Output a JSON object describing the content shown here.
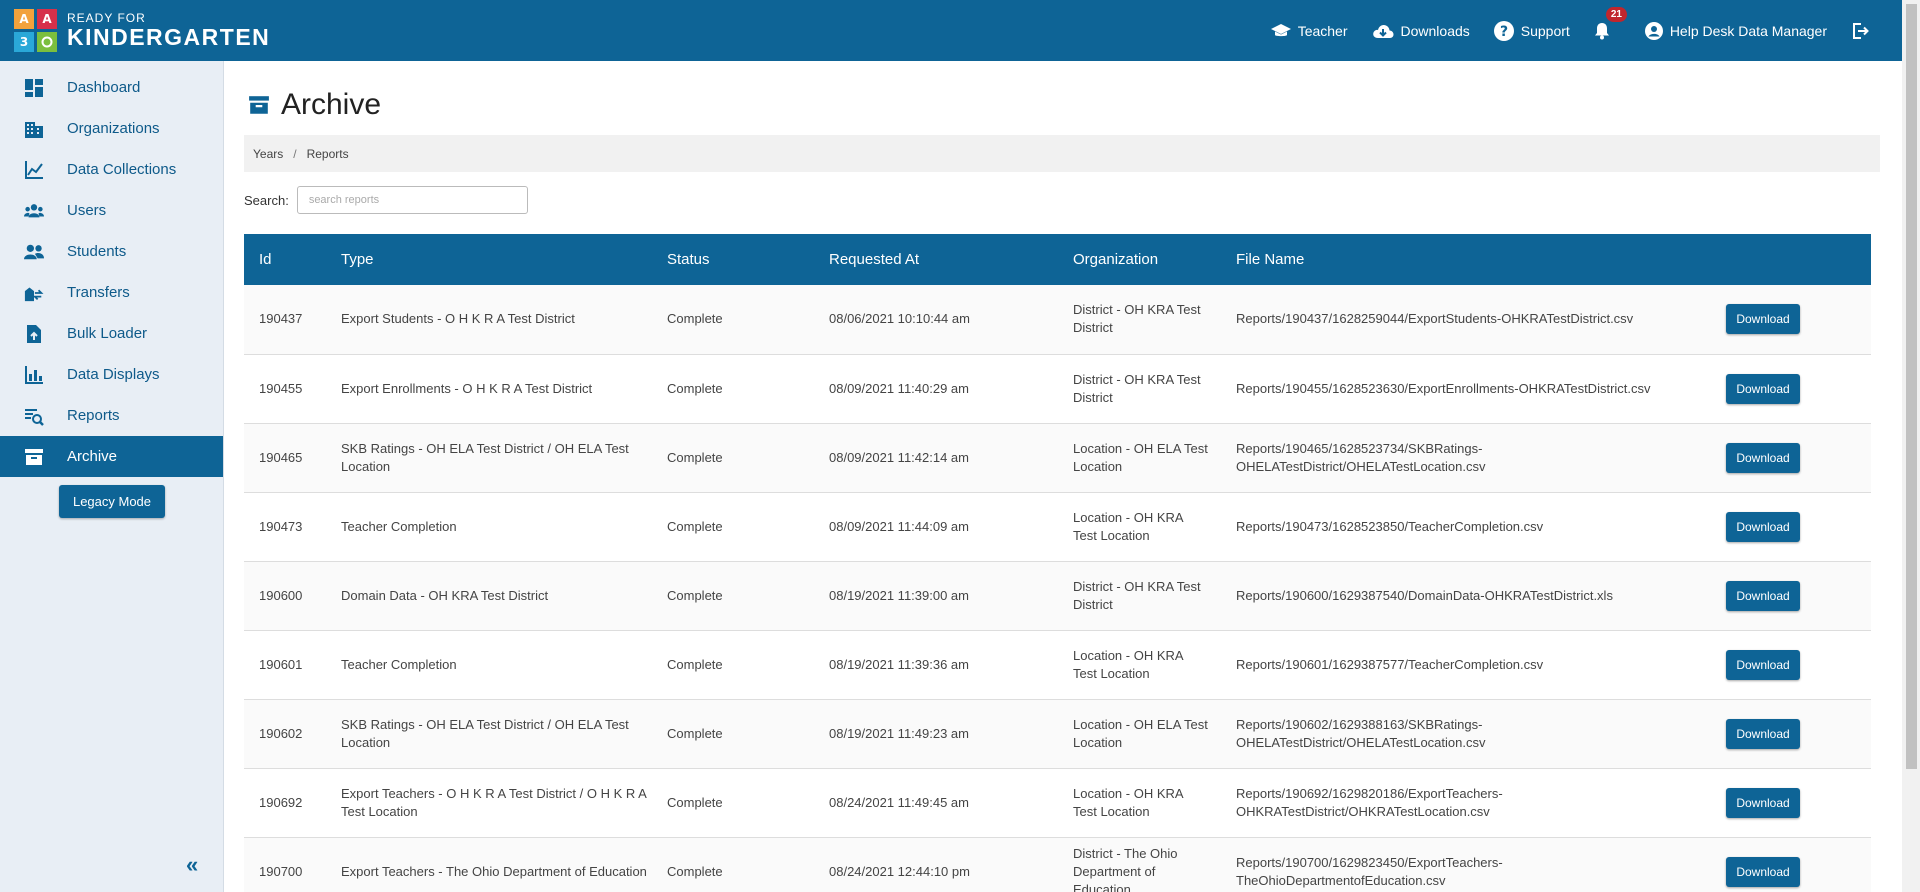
{
  "brand": {
    "blocks": [
      "A",
      "A",
      "3",
      ""
    ],
    "line1": "READY FOR",
    "line2": "KINDERGARTEN"
  },
  "header": {
    "teacher": "Teacher",
    "downloads": "Downloads",
    "support": "Support",
    "notification_count": "21",
    "user": "Help Desk Data Manager"
  },
  "sidebar": {
    "items": [
      {
        "label": "Dashboard",
        "icon": "dashboard-icon"
      },
      {
        "label": "Organizations",
        "icon": "building-icon"
      },
      {
        "label": "Data Collections",
        "icon": "line-chart-icon"
      },
      {
        "label": "Users",
        "icon": "users-icon"
      },
      {
        "label": "Students",
        "icon": "students-icon"
      },
      {
        "label": "Transfers",
        "icon": "transfer-icon"
      },
      {
        "label": "Bulk Loader",
        "icon": "file-upload-icon"
      },
      {
        "label": "Data Displays",
        "icon": "bar-chart-icon"
      },
      {
        "label": "Reports",
        "icon": "report-search-icon"
      },
      {
        "label": "Archive",
        "icon": "archive-icon"
      }
    ],
    "active": "Archive",
    "legacy_label": "Legacy Mode",
    "collapse": "«"
  },
  "page": {
    "title": "Archive",
    "breadcrumb": [
      "Years",
      "Reports"
    ],
    "breadcrumb_sep": "/",
    "search_label": "Search:",
    "search_placeholder": "search reports"
  },
  "table": {
    "headers": [
      "Id",
      "Type",
      "Status",
      "Requested At",
      "Organization",
      "File Name",
      ""
    ],
    "download_label": "Download",
    "rows": [
      {
        "id": "190437",
        "type": "Export Students - O H K R A Test District",
        "status": "Complete",
        "requested": "08/06/2021 10:10:44 am",
        "org": "District - OH KRA Test District",
        "file": "Reports/190437/1628259044/ExportStudents-OHKRATestDistrict.csv"
      },
      {
        "id": "190455",
        "type": "Export Enrollments - O H K R A Test District",
        "status": "Complete",
        "requested": "08/09/2021 11:40:29 am",
        "org": "District - OH KRA Test District",
        "file": "Reports/190455/1628523630/ExportEnrollments-OHKRATestDistrict.csv"
      },
      {
        "id": "190465",
        "type": "SKB Ratings - OH ELA Test District / OH ELA Test Location",
        "status": "Complete",
        "requested": "08/09/2021 11:42:14 am",
        "org": "Location - OH ELA Test Location",
        "file": "Reports/190465/1628523734/SKBRatings-OHELATestDistrict/OHELATestLocation.csv"
      },
      {
        "id": "190473",
        "type": "Teacher Completion",
        "status": "Complete",
        "requested": "08/09/2021 11:44:09 am",
        "org": "Location - OH KRA Test Location",
        "file": "Reports/190473/1628523850/TeacherCompletion.csv"
      },
      {
        "id": "190600",
        "type": "Domain Data - OH KRA Test District",
        "status": "Complete",
        "requested": "08/19/2021 11:39:00 am",
        "org": "District - OH KRA Test District",
        "file": "Reports/190600/1629387540/DomainData-OHKRATestDistrict.xls"
      },
      {
        "id": "190601",
        "type": "Teacher Completion",
        "status": "Complete",
        "requested": "08/19/2021 11:39:36 am",
        "org": "Location - OH KRA Test Location",
        "file": "Reports/190601/1629387577/TeacherCompletion.csv"
      },
      {
        "id": "190602",
        "type": "SKB Ratings - OH ELA Test District / OH ELA Test Location",
        "status": "Complete",
        "requested": "08/19/2021 11:49:23 am",
        "org": "Location - OH ELA Test Location",
        "file": "Reports/190602/1629388163/SKBRatings-OHELATestDistrict/OHELATestLocation.csv"
      },
      {
        "id": "190692",
        "type": "Export Teachers - O H K R A Test District / O H K R A Test Location",
        "status": "Complete",
        "requested": "08/24/2021 11:49:45 am",
        "org": "Location - OH KRA Test Location",
        "file": "Reports/190692/1629820186/ExportTeachers-OHKRATestDistrict/OHKRATestLocation.csv"
      },
      {
        "id": "190700",
        "type": "Export Teachers - The Ohio Department of Education",
        "status": "Complete",
        "requested": "08/24/2021 12:44:10 pm",
        "org": "District - The Ohio Department of Education",
        "file": "Reports/190700/1629823450/ExportTeachers-TheOhioDepartmentofEducation.csv"
      }
    ]
  },
  "colors": {
    "primary": "#0e6496",
    "sidebar_bg": "#e8eef5",
    "badge": "#c0262d"
  }
}
